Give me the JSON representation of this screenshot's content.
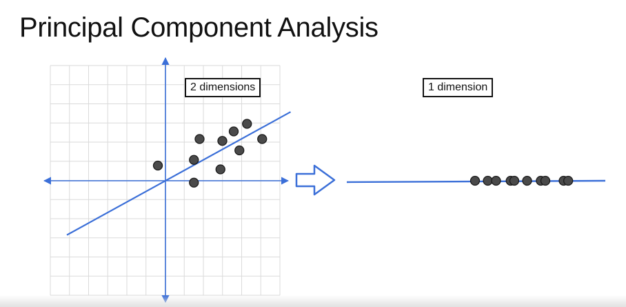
{
  "slide": {
    "title": "Principal Component Analysis",
    "label_2d": "2 dimensions",
    "label_1d": "1 dimension"
  },
  "colors": {
    "axis": "#3B6FD8",
    "grid": "#DADADA",
    "point_fill": "#4a4a4a",
    "point_stroke": "#1a1a1a",
    "arrow": "#3B6FD8"
  },
  "icons": {
    "transform_arrow": "right-arrow-outline-icon"
  },
  "chart_data": {
    "type": "scatter",
    "xlim": [
      -6,
      6
    ],
    "ylim": [
      -6,
      6
    ],
    "grid": true,
    "points": [
      {
        "x": -0.4,
        "y": 0.8
      },
      {
        "x": 1.5,
        "y": 1.1
      },
      {
        "x": 1.5,
        "y": -0.1
      },
      {
        "x": 1.8,
        "y": 2.2
      },
      {
        "x": 2.9,
        "y": 0.6
      },
      {
        "x": 3.0,
        "y": 2.1
      },
      {
        "x": 3.6,
        "y": 2.6
      },
      {
        "x": 3.9,
        "y": 1.6
      },
      {
        "x": 4.3,
        "y": 3.0
      },
      {
        "x": 5.1,
        "y": 2.2
      }
    ],
    "principal_component": {
      "slope": 0.55,
      "x_range": [
        -5.2,
        6.6
      ]
    },
    "projected_1d": [
      0.0,
      0.7,
      1.15,
      1.95,
      2.15,
      2.85,
      3.6,
      3.85,
      4.85,
      5.1
    ]
  }
}
